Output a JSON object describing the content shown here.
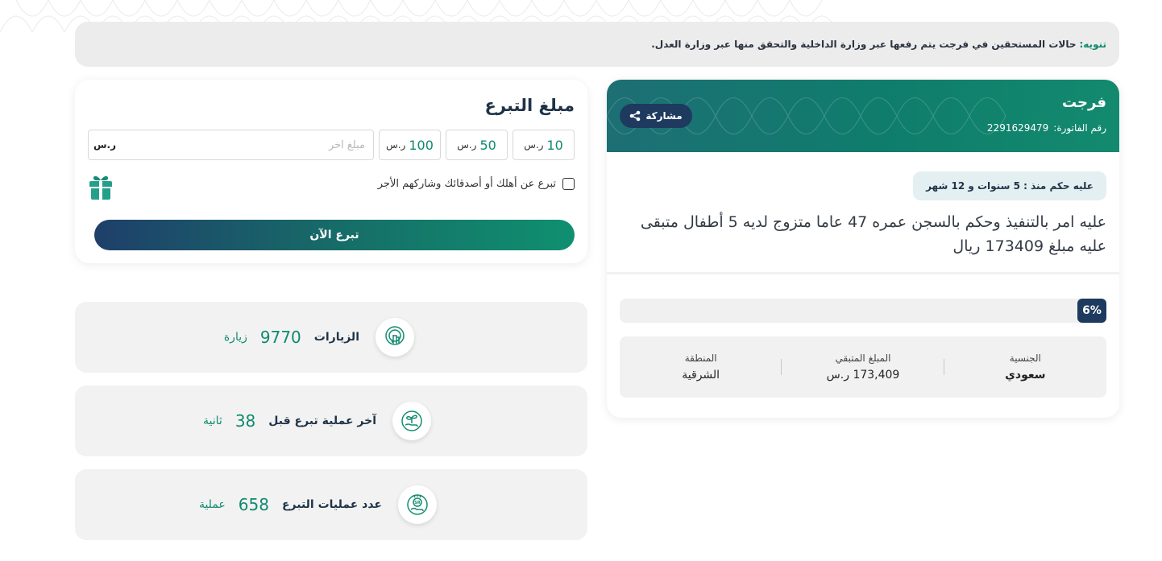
{
  "notice": {
    "lead": "تنويه:",
    "text": "حالات المستحقين في فرجت يتم رفعها عبر وزارة الداخلية والتحقق منها عبر وزارة العدل."
  },
  "case": {
    "title": "فرجت",
    "invoice_label": "رقم الفاتورة:",
    "invoice_number": "2291629479",
    "share_label": "مشاركة",
    "sentence": "عليه حكم منذ : 5 سنوات و 12 شهر",
    "description": "عليه امر بالتنفيذ وحكم بالسجن عمره 47 عاما متزوج لديه 5 أطفال متبقى عليه مبلغ 173409 ريال",
    "progress_percent_label": "6%",
    "progress_fraction": 0.06,
    "stats": [
      {
        "label": "الجنسية",
        "value": "سعودي"
      },
      {
        "label": "المبلغ المتبقي",
        "value": "173,409 ر.س"
      },
      {
        "label": "المنطقة",
        "value": "الشرقية"
      }
    ]
  },
  "donate": {
    "title": "مبلغ التبرع",
    "amounts": [
      {
        "value": "10",
        "currency": "ر.س"
      },
      {
        "value": "50",
        "currency": "ر.س"
      },
      {
        "value": "100",
        "currency": "ر.س"
      }
    ],
    "other_placeholder": "مبلغ آخر",
    "other_currency": "ر.س",
    "gift_label": "تبرع عن أهلك أو أصدقائك وشاركهم الأجر",
    "submit_label": "تبرع الآن"
  },
  "info": [
    {
      "label": "الزيارات",
      "value": "9770",
      "unit": "زيارة",
      "icon": "touch-icon"
    },
    {
      "label": "آخر عملية تبرع قبل",
      "value": "38",
      "unit": "ثانية",
      "icon": "plant-hand-icon"
    },
    {
      "label": "عدد عمليات التبرع",
      "value": "658",
      "unit": "عملية",
      "icon": "riyal-hand-icon"
    }
  ],
  "colors": {
    "primary_green": "#0f8a6f",
    "navy": "#1e3a5f",
    "header_teal": "#0f7d6c"
  }
}
